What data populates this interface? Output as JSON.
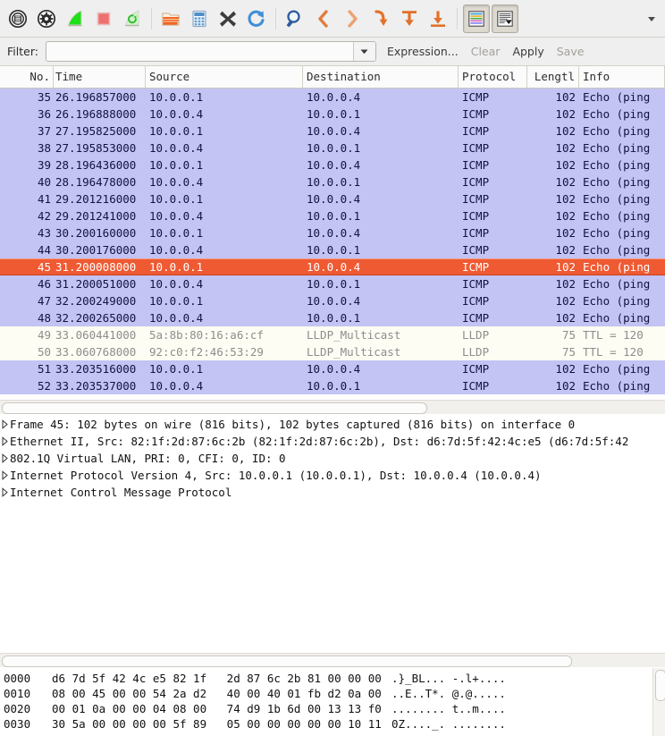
{
  "toolbar": {
    "buttons": [
      {
        "name": "interfaces-list-icon",
        "title": "List the available capture interfaces",
        "pressed": false
      },
      {
        "name": "capture-options-icon",
        "title": "Show the capture options",
        "pressed": false
      },
      {
        "name": "start-capture-icon",
        "title": "Start a new live capture",
        "pressed": false
      },
      {
        "name": "stop-capture-icon",
        "title": "Stop the running live capture",
        "pressed": false
      },
      {
        "name": "restart-capture-icon",
        "title": "Restart the running live capture",
        "pressed": false
      },
      {
        "name": "open-file-icon",
        "title": "Open a capture file",
        "pressed": false
      },
      {
        "name": "save-file-icon",
        "title": "Save this capture file",
        "pressed": false
      },
      {
        "name": "close-file-icon",
        "title": "Close this capture file",
        "pressed": false
      },
      {
        "name": "reload-file-icon",
        "title": "Reload this capture file",
        "pressed": false
      },
      {
        "name": "find-packet-icon",
        "title": "Find a packet",
        "pressed": false
      },
      {
        "name": "go-back-icon",
        "title": "Go back in packet history",
        "pressed": false
      },
      {
        "name": "go-forward-icon",
        "title": "Go forward in packet history",
        "pressed": false
      },
      {
        "name": "go-to-packet-icon",
        "title": "Go to the packet with number",
        "pressed": false
      },
      {
        "name": "go-to-first-packet-icon",
        "title": "Go to the first packet",
        "pressed": false
      },
      {
        "name": "go-to-last-packet-icon",
        "title": "Go to the last packet",
        "pressed": false
      },
      {
        "name": "colorize-packets-icon",
        "title": "Colorize packet list",
        "pressed": true
      },
      {
        "name": "auto-scroll-icon",
        "title": "Auto scroll in live capture",
        "pressed": true
      }
    ],
    "overflow_label": "▾"
  },
  "filter_bar": {
    "label": "Filter:",
    "value": "",
    "placeholder": "",
    "dropdown_glyph": "▾",
    "expression_label": "Expression...",
    "clear_label": "Clear",
    "apply_label": "Apply",
    "save_label": "Save"
  },
  "packet_list": {
    "columns": [
      {
        "key": "no",
        "label": "No."
      },
      {
        "key": "time",
        "label": "Time"
      },
      {
        "key": "src",
        "label": "Source"
      },
      {
        "key": "dst",
        "label": "Destination"
      },
      {
        "key": "proto",
        "label": "Protocol"
      },
      {
        "key": "len",
        "label": "Lengtl"
      },
      {
        "key": "info",
        "label": "Info"
      }
    ],
    "rows": [
      {
        "no": "35",
        "time": "26.196857000",
        "src": "10.0.0.1",
        "dst": "10.0.0.4",
        "proto": "ICMP",
        "len": "102",
        "info": "Echo (ping",
        "style": "icmp"
      },
      {
        "no": "36",
        "time": "26.196888000",
        "src": "10.0.0.4",
        "dst": "10.0.0.1",
        "proto": "ICMP",
        "len": "102",
        "info": "Echo (ping",
        "style": "icmp"
      },
      {
        "no": "37",
        "time": "27.195825000",
        "src": "10.0.0.1",
        "dst": "10.0.0.4",
        "proto": "ICMP",
        "len": "102",
        "info": "Echo (ping",
        "style": "icmp"
      },
      {
        "no": "38",
        "time": "27.195853000",
        "src": "10.0.0.4",
        "dst": "10.0.0.1",
        "proto": "ICMP",
        "len": "102",
        "info": "Echo (ping",
        "style": "icmp"
      },
      {
        "no": "39",
        "time": "28.196436000",
        "src": "10.0.0.1",
        "dst": "10.0.0.4",
        "proto": "ICMP",
        "len": "102",
        "info": "Echo (ping",
        "style": "icmp"
      },
      {
        "no": "40",
        "time": "28.196478000",
        "src": "10.0.0.4",
        "dst": "10.0.0.1",
        "proto": "ICMP",
        "len": "102",
        "info": "Echo (ping",
        "style": "icmp"
      },
      {
        "no": "41",
        "time": "29.201216000",
        "src": "10.0.0.1",
        "dst": "10.0.0.4",
        "proto": "ICMP",
        "len": "102",
        "info": "Echo (ping",
        "style": "icmp"
      },
      {
        "no": "42",
        "time": "29.201241000",
        "src": "10.0.0.4",
        "dst": "10.0.0.1",
        "proto": "ICMP",
        "len": "102",
        "info": "Echo (ping",
        "style": "icmp"
      },
      {
        "no": "43",
        "time": "30.200160000",
        "src": "10.0.0.1",
        "dst": "10.0.0.4",
        "proto": "ICMP",
        "len": "102",
        "info": "Echo (ping",
        "style": "icmp"
      },
      {
        "no": "44",
        "time": "30.200176000",
        "src": "10.0.0.4",
        "dst": "10.0.0.1",
        "proto": "ICMP",
        "len": "102",
        "info": "Echo (ping",
        "style": "icmp"
      },
      {
        "no": "45",
        "time": "31.200008000",
        "src": "10.0.0.1",
        "dst": "10.0.0.4",
        "proto": "ICMP",
        "len": "102",
        "info": "Echo (ping",
        "style": "selected"
      },
      {
        "no": "46",
        "time": "31.200051000",
        "src": "10.0.0.4",
        "dst": "10.0.0.1",
        "proto": "ICMP",
        "len": "102",
        "info": "Echo (ping",
        "style": "icmp"
      },
      {
        "no": "47",
        "time": "32.200249000",
        "src": "10.0.0.1",
        "dst": "10.0.0.4",
        "proto": "ICMP",
        "len": "102",
        "info": "Echo (ping",
        "style": "icmp"
      },
      {
        "no": "48",
        "time": "32.200265000",
        "src": "10.0.0.4",
        "dst": "10.0.0.1",
        "proto": "ICMP",
        "len": "102",
        "info": "Echo (ping",
        "style": "icmp"
      },
      {
        "no": "49",
        "time": "33.060441000",
        "src": "5a:8b:80:16:a6:cf",
        "dst": "LLDP_Multicast",
        "proto": "LLDP",
        "len": "75",
        "info": "TTL = 120",
        "style": "lldp"
      },
      {
        "no": "50",
        "time": "33.060768000",
        "src": "92:c0:f2:46:53:29",
        "dst": "LLDP_Multicast",
        "proto": "LLDP",
        "len": "75",
        "info": "TTL = 120",
        "style": "lldp"
      },
      {
        "no": "51",
        "time": "33.203516000",
        "src": "10.0.0.1",
        "dst": "10.0.0.4",
        "proto": "ICMP",
        "len": "102",
        "info": "Echo (ping",
        "style": "icmp"
      },
      {
        "no": "52",
        "time": "33.203537000",
        "src": "10.0.0.4",
        "dst": "10.0.0.1",
        "proto": "ICMP",
        "len": "102",
        "info": "Echo (ping",
        "style": "icmp"
      }
    ]
  },
  "packet_detail": {
    "rows": [
      "Frame 45: 102 bytes on wire (816 bits), 102 bytes captured (816 bits) on interface 0",
      "Ethernet II, Src: 82:1f:2d:87:6c:2b (82:1f:2d:87:6c:2b), Dst: d6:7d:5f:42:4c:e5 (d6:7d:5f:42",
      "802.1Q Virtual LAN, PRI: 0, CFI: 0, ID: 0",
      "Internet Protocol Version 4, Src: 10.0.0.1 (10.0.0.1), Dst: 10.0.0.4 (10.0.0.4)",
      "Internet Control Message Protocol"
    ]
  },
  "hex_dump": {
    "rows": [
      {
        "offset": "0000",
        "hex": "d6 7d 5f 42 4c e5 82 1f   2d 87 6c 2b 81 00 00 00",
        "ascii": ".}_BL... -.l+...."
      },
      {
        "offset": "0010",
        "hex": "08 00 45 00 00 54 2a d2   40 00 40 01 fb d2 0a 00",
        "ascii": "..E..T*. @.@....."
      },
      {
        "offset": "0020",
        "hex": "00 01 0a 00 00 04 08 00   74 d9 1b 6d 00 13 13 f0",
        "ascii": "........ t..m...."
      },
      {
        "offset": "0030",
        "hex": "30 5a 00 00 00 00 5f 89   05 00 00 00 00 00 10 11",
        "ascii": "0Z...._. ........"
      }
    ]
  },
  "colors": {
    "icmp_row_bg": "#c3c3f4",
    "lldp_row_bg": "#fdfdf3",
    "selected_row_bg": "#ef5a33",
    "toolbar_bg": "#efefef",
    "accent_orange": "#e8833a"
  }
}
